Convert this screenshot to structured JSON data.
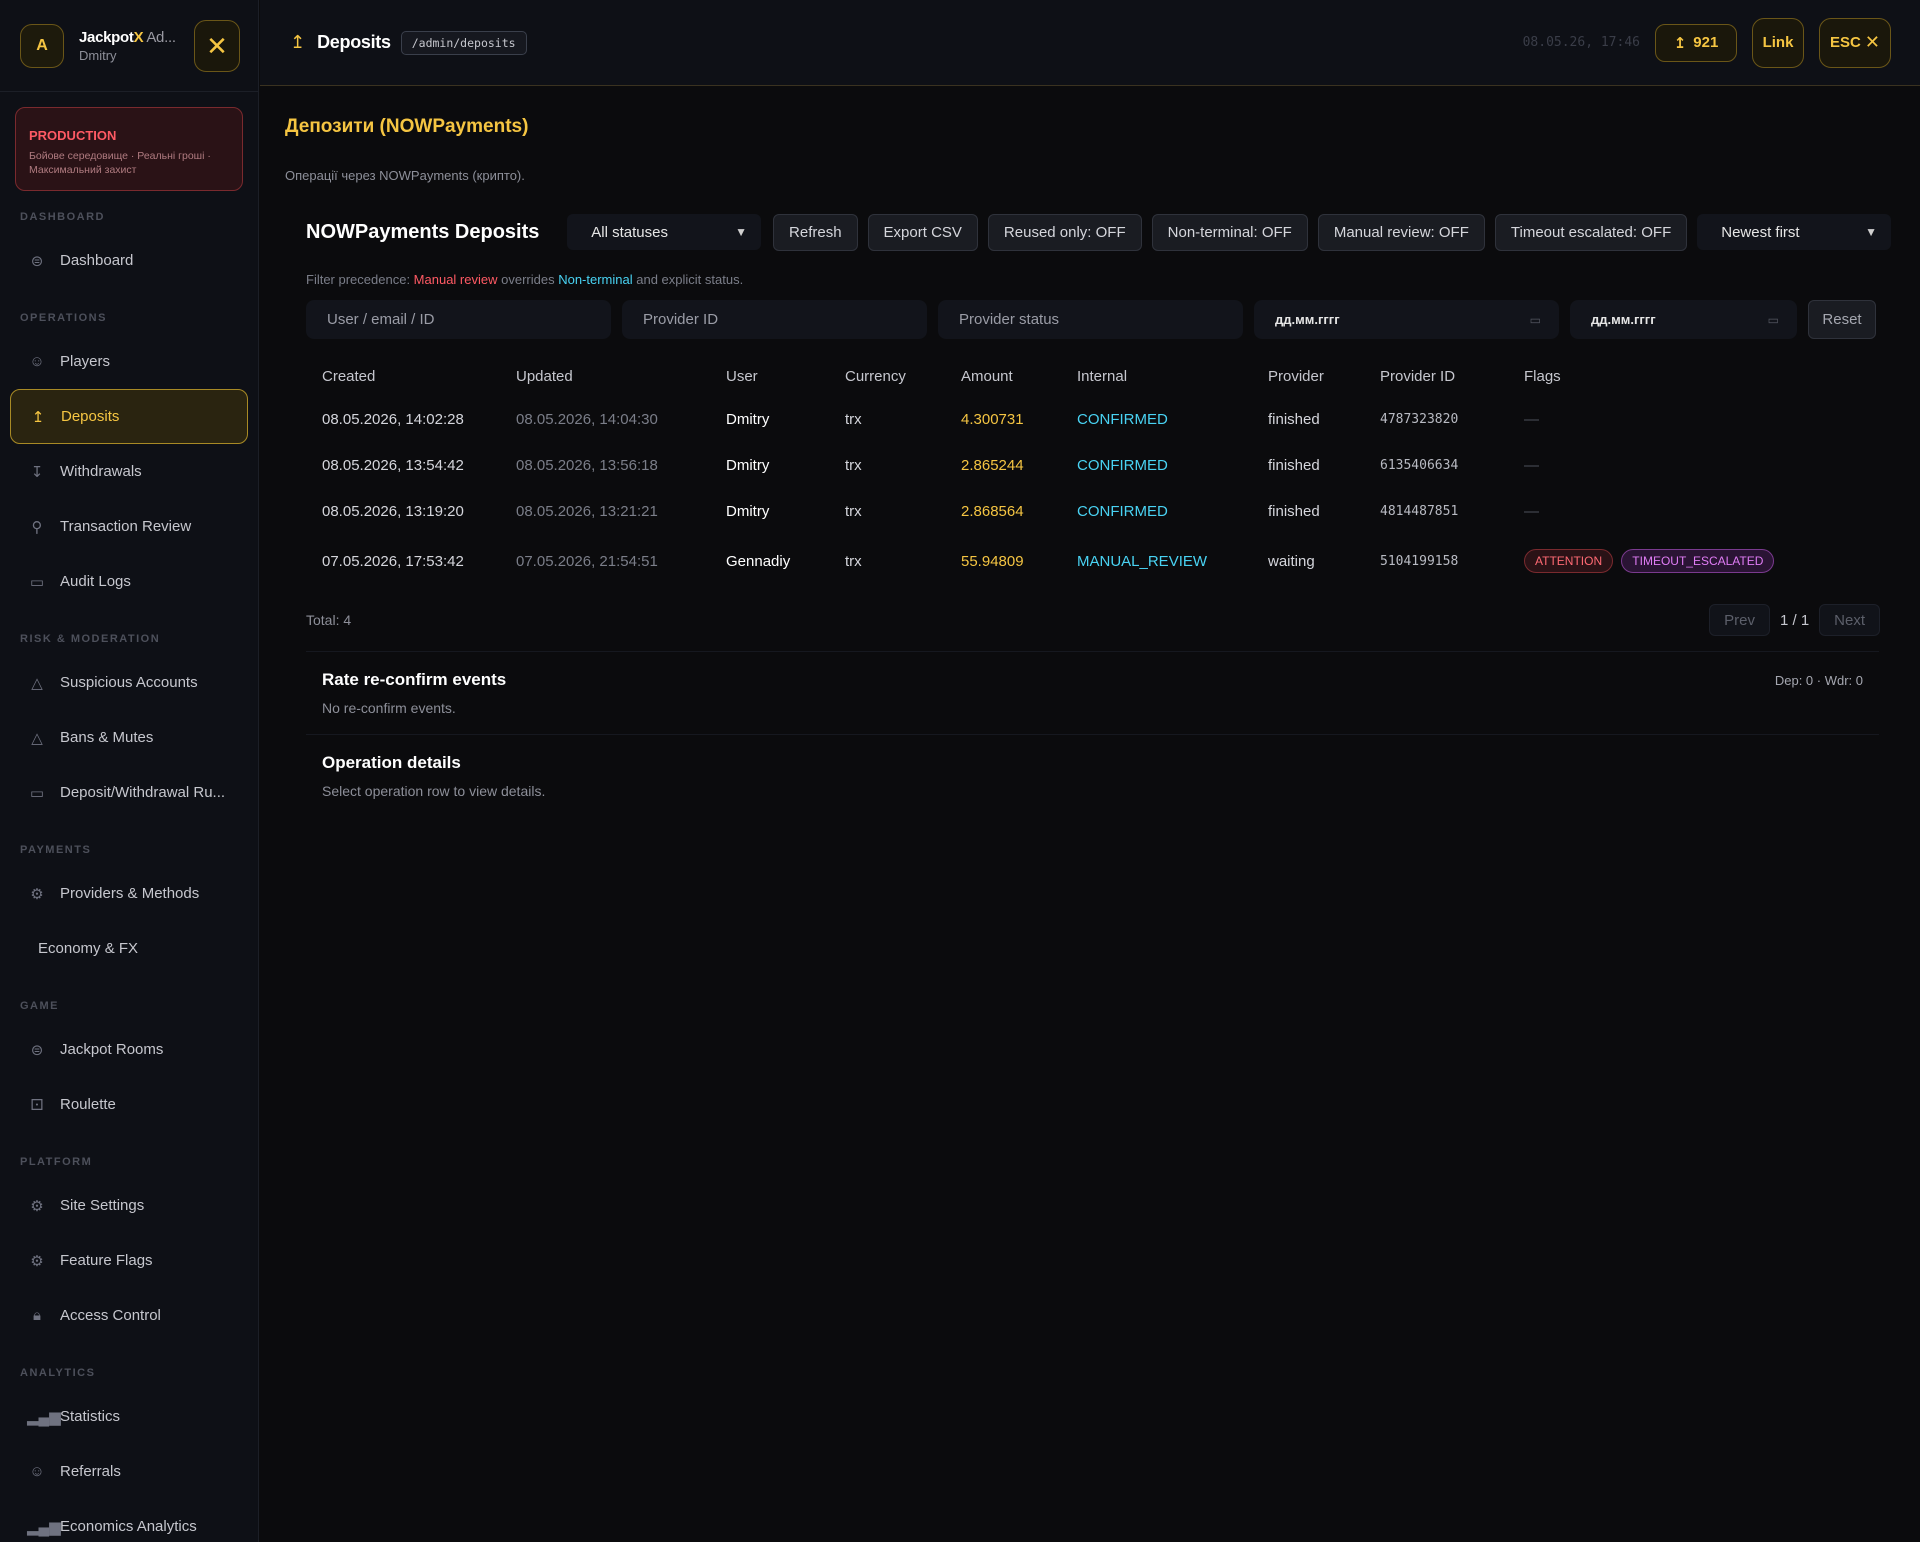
{
  "brand": {
    "avatar": "A",
    "name_prefix": "Jackpot",
    "name_x": "X",
    "name_rest": " Ad...",
    "user": "Dmitry",
    "close_icon": "close-icon"
  },
  "production": {
    "title": "PRODUCTION",
    "subtitle": "Бойове середовище · Реальні гроші · Максимальний захист"
  },
  "sidebar": {
    "sections": {
      "dashboard": "DASHBOARD",
      "operations": "OPERATIONS",
      "risk": "RISK & MODERATION",
      "payments": "PAYMENTS",
      "game": "GAME",
      "platform": "PLATFORM",
      "analytics": "ANALYTICS"
    },
    "items": {
      "dashboard": "Dashboard",
      "players": "Players",
      "deposits": "Deposits",
      "withdrawals": "Withdrawals",
      "transaction_review": "Transaction Review",
      "audit_logs": "Audit Logs",
      "suspicious_accounts": "Suspicious Accounts",
      "bans_mutes": "Bans & Mutes",
      "dw_rules": "Deposit/Withdrawal Ru...",
      "providers_methods": "Providers & Methods",
      "economy_fx": "Economy & FX",
      "jackpot_rooms": "Jackpot Rooms",
      "roulette": "Roulette",
      "site_settings": "Site Settings",
      "feature_flags": "Feature Flags",
      "access_control": "Access Control",
      "statistics": "Statistics",
      "referrals": "Referrals",
      "economics_analytics": "Economics Analytics"
    }
  },
  "topbar": {
    "title": "Deposits",
    "path": "/admin/deposits",
    "time": "08.05.26, 17:46",
    "count": "921",
    "link_label": "Link",
    "esc_label": "ESC"
  },
  "page": {
    "title": "Депозити (NOWPayments)",
    "subtitle": "Операції через NOWPayments (крипто)."
  },
  "toolbar": {
    "card_title": "NOWPayments Deposits",
    "status_select": "All statuses",
    "refresh": "Refresh",
    "export": "Export CSV",
    "reused": "Reused only: OFF",
    "nonterminal": "Non-terminal: OFF",
    "manual": "Manual review: OFF",
    "timeout": "Timeout escalated: OFF",
    "sort_select": "Newest first"
  },
  "precedence": {
    "prefix": "Filter precedence: ",
    "manual": "Manual review",
    "overrides": " overrides ",
    "nonterminal": "Non-terminal",
    "suffix": " and explicit status."
  },
  "filters": {
    "user_placeholder": "User / email / ID",
    "provider_id_placeholder": "Provider ID",
    "provider_status_placeholder": "Provider status",
    "date_from": "дд.мм.гггг",
    "date_to": "дд.мм.гггг",
    "reset": "Reset"
  },
  "table": {
    "headers": [
      "Created",
      "Updated",
      "User",
      "Currency",
      "Amount",
      "Internal",
      "Provider",
      "Provider ID",
      "Flags"
    ],
    "rows": [
      {
        "created": "08.05.2026, 14:02:28",
        "updated": "08.05.2026, 14:04:30",
        "user": "Dmitry",
        "currency": "trx",
        "amount": "4.300731",
        "internal": "CONFIRMED",
        "provider": "finished",
        "provider_id": "4787323820",
        "flags": "—"
      },
      {
        "created": "08.05.2026, 13:54:42",
        "updated": "08.05.2026, 13:56:18",
        "user": "Dmitry",
        "currency": "trx",
        "amount": "2.865244",
        "internal": "CONFIRMED",
        "provider": "finished",
        "provider_id": "6135406634",
        "flags": "—"
      },
      {
        "created": "08.05.2026, 13:19:20",
        "updated": "08.05.2026, 13:21:21",
        "user": "Dmitry",
        "currency": "trx",
        "amount": "2.868564",
        "internal": "CONFIRMED",
        "provider": "finished",
        "provider_id": "4814487851",
        "flags": "—"
      },
      {
        "created": "07.05.2026, 17:53:42",
        "updated": "07.05.2026, 21:54:51",
        "user": "Gennadiy",
        "currency": "trx",
        "amount": "55.94809",
        "internal": "MANUAL_REVIEW",
        "provider": "waiting",
        "provider_id": "5104199158",
        "flag_badges": [
          "ATTENTION",
          "TIMEOUT_ESCALATED"
        ]
      }
    ]
  },
  "pager": {
    "total": "Total: 4",
    "prev": "Prev",
    "page": "1 / 1",
    "next": "Next"
  },
  "reconfirm": {
    "title": "Rate re-confirm events",
    "stats": "Dep: 0 · Wdr: 0",
    "empty": "No re-confirm events."
  },
  "details": {
    "title": "Operation details",
    "empty": "Select operation row to view details."
  },
  "colors": {
    "accent": "#f5c542",
    "danger": "#ff5a64",
    "info": "#49d3f3",
    "purple": "#e07cf5"
  }
}
